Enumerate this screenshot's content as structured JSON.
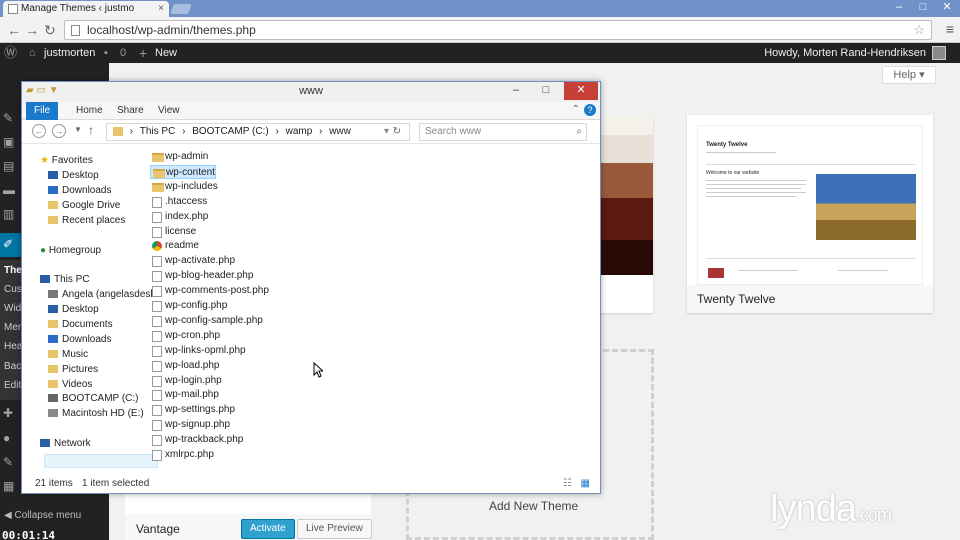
{
  "browser": {
    "tab_title": "Manage Themes ‹ justmo",
    "tab_close": "×",
    "url": "localhost/wp-admin/themes.php",
    "back_icon": "←",
    "forward_icon": "→",
    "reload_icon": "↻",
    "star_icon": "☆",
    "menu_icon": "≡",
    "min": "–",
    "max": "□",
    "close": "✕"
  },
  "adminbar": {
    "site_name": "justmorten",
    "comments_count": "0",
    "new_label": "New",
    "howdy": "Howdy, Morten Rand-Hendriksen"
  },
  "sidebar": {
    "visible_labels": [
      "The",
      "Cus",
      "Wid",
      "Men",
      "Hea",
      "Bac",
      "Edit"
    ],
    "collapse_label": "Collapse menu"
  },
  "timer": "00:01:14",
  "help_label": "Help ▾",
  "themes": {
    "twenty_twelve_name": "Twenty Twelve",
    "twenty_twelve_preview_title": "Twenty Twelve",
    "twenty_twelve_preview_heading": "Welcome to our website",
    "vantage_name": "Vantage",
    "activate_label": "Activate",
    "live_preview_label": "Live Preview",
    "add_new_label": "Add New Theme"
  },
  "watermark": "lynda.com",
  "explorer": {
    "title": "www",
    "ribbon_tabs": [
      "File",
      "Home",
      "Share",
      "View"
    ],
    "breadcrumbs": [
      "This PC",
      "›",
      "BOOTCAMP (C:)",
      "›",
      "wamp",
      "›",
      "www"
    ],
    "search_placeholder": "Search www",
    "nav": {
      "favorites": "Favorites",
      "desktop": "Desktop",
      "downloads": "Downloads",
      "google_drive": "Google Drive",
      "recent_places": "Recent places",
      "homegroup": "Homegroup",
      "this_pc": "This PC",
      "angela": "Angela (angelasdesk",
      "pc_desktop": "Desktop",
      "documents": "Documents",
      "pc_downloads": "Downloads",
      "music": "Music",
      "pictures": "Pictures",
      "videos": "Videos",
      "bootcamp": "BOOTCAMP (C:)",
      "macintosh": "Macintosh HD (E:)",
      "network": "Network"
    },
    "files": [
      {
        "name": "wp-admin",
        "type": "folder"
      },
      {
        "name": "wp-content",
        "type": "folder"
      },
      {
        "name": "wp-includes",
        "type": "folder"
      },
      {
        "name": ".htaccess",
        "type": "file"
      },
      {
        "name": "index.php",
        "type": "file"
      },
      {
        "name": "license",
        "type": "file"
      },
      {
        "name": "readme",
        "type": "chrome"
      },
      {
        "name": "wp-activate.php",
        "type": "file"
      },
      {
        "name": "wp-blog-header.php",
        "type": "file"
      },
      {
        "name": "wp-comments-post.php",
        "type": "file"
      },
      {
        "name": "wp-config.php",
        "type": "file"
      },
      {
        "name": "wp-config-sample.php",
        "type": "file"
      },
      {
        "name": "wp-cron.php",
        "type": "file"
      },
      {
        "name": "wp-links-opml.php",
        "type": "file"
      },
      {
        "name": "wp-load.php",
        "type": "file"
      },
      {
        "name": "wp-login.php",
        "type": "file"
      },
      {
        "name": "wp-mail.php",
        "type": "file"
      },
      {
        "name": "wp-settings.php",
        "type": "file"
      },
      {
        "name": "wp-signup.php",
        "type": "file"
      },
      {
        "name": "wp-trackback.php",
        "type": "file"
      },
      {
        "name": "xmlrpc.php",
        "type": "file"
      }
    ],
    "selected_file": "wp-content",
    "status_items": "21 items",
    "status_selected": "1 item selected"
  }
}
